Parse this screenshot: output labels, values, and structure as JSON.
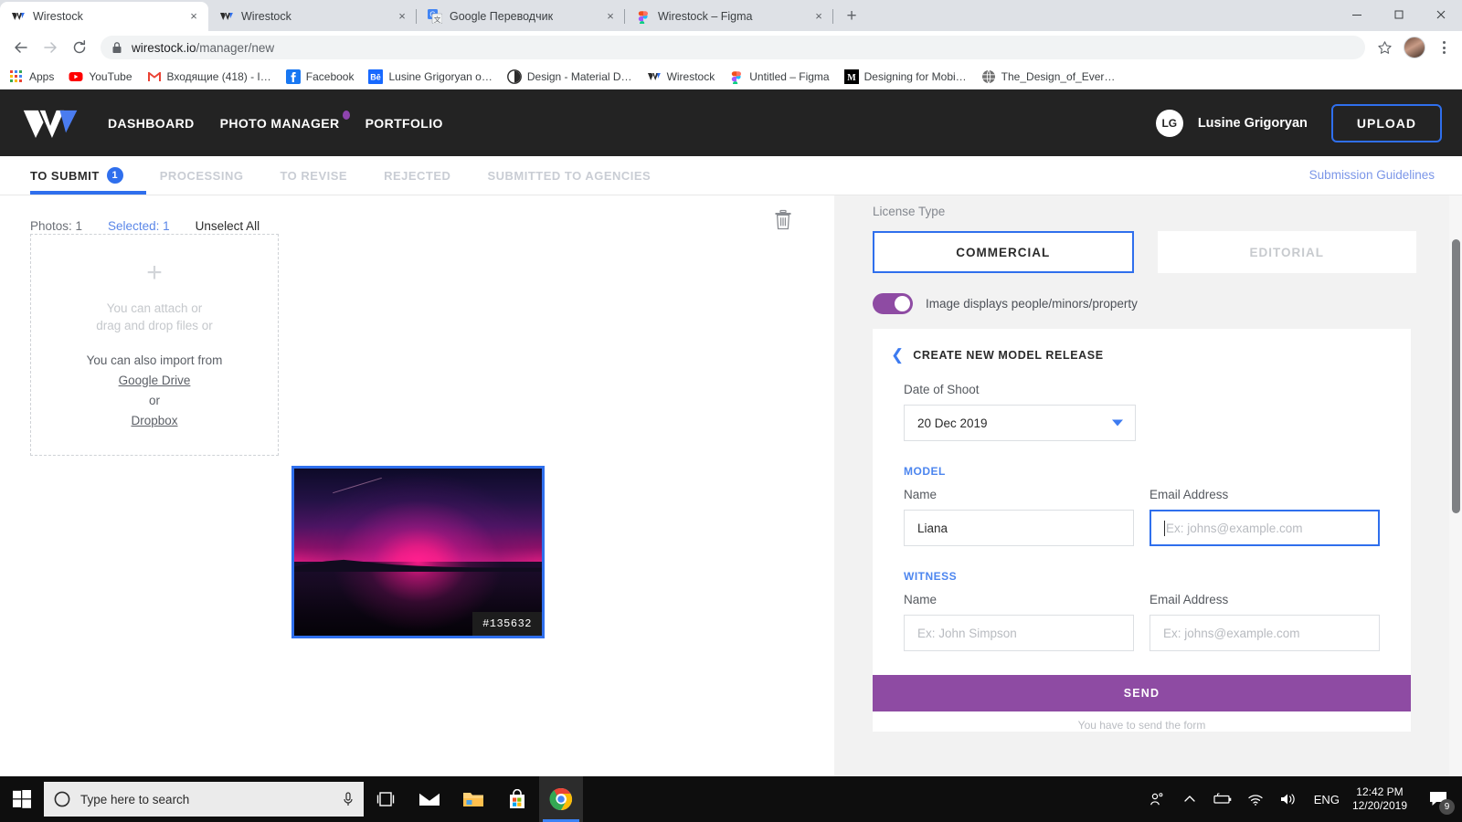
{
  "browser": {
    "tabs": [
      {
        "title": "Wirestock",
        "favicon": "wirestock-icon",
        "active": true,
        "close_label": "×"
      },
      {
        "title": "Wirestock",
        "favicon": "wirestock-icon",
        "active": false,
        "close_label": "×"
      },
      {
        "title": "Google Переводчик",
        "favicon": "google-translate-icon",
        "active": false,
        "close_label": "×"
      },
      {
        "title": "Wirestock – Figma",
        "favicon": "figma-icon",
        "active": false,
        "close_label": "×"
      }
    ],
    "new_tab_label": "+",
    "window_controls": {
      "minimize": "minimize-icon",
      "maximize": "maximize-icon",
      "close": "close-icon"
    },
    "url_host": "wirestock.io",
    "url_path": "/manager/new",
    "bookmarks": [
      {
        "label": "Apps",
        "icon": "apps-grid-icon"
      },
      {
        "label": "YouTube",
        "icon": "youtube-icon"
      },
      {
        "label": "Входящие (418) - I…",
        "icon": "gmail-icon"
      },
      {
        "label": "Facebook",
        "icon": "facebook-icon"
      },
      {
        "label": "Lusine Grigoryan o…",
        "icon": "behance-icon"
      },
      {
        "label": "Design - Material D…",
        "icon": "material-design-icon"
      },
      {
        "label": "Wirestock",
        "icon": "wirestock-icon"
      },
      {
        "label": "Untitled – Figma",
        "icon": "figma-icon"
      },
      {
        "label": "Designing for Mobi…",
        "icon": "medium-icon"
      },
      {
        "label": "The_Design_of_Ever…",
        "icon": "globe-icon"
      }
    ]
  },
  "app": {
    "logo": "wirestock-logo",
    "nav": [
      {
        "label": "DASHBOARD",
        "dot": false
      },
      {
        "label": "PHOTO MANAGER",
        "dot": true
      },
      {
        "label": "PORTFOLIO",
        "dot": false
      }
    ],
    "user": {
      "initials": "LG",
      "name": "Lusine Grigoryan"
    },
    "upload_label": "UPLOAD",
    "tabs": [
      {
        "label": "TO SUBMIT",
        "count": "1",
        "active": true
      },
      {
        "label": "PROCESSING",
        "count": "",
        "active": false
      },
      {
        "label": "TO REVISE",
        "count": "",
        "active": false
      },
      {
        "label": "REJECTED",
        "count": "",
        "active": false
      },
      {
        "label": "SUBMITTED TO AGENCIES",
        "count": "",
        "active": false
      }
    ],
    "guidelines_label": "Submission Guidelines",
    "accent_blue": "#2f6fed",
    "accent_purple": "#8e4ba3"
  },
  "left": {
    "stats": {
      "photos": "Photos: 1",
      "selected": "Selected: 1",
      "unselect_all": "Unselect All"
    },
    "trash_icon": "trash-icon",
    "dropzone": {
      "plus": "+",
      "line1": "You can attach or",
      "line2": "drag and drop files or",
      "line3": "You can also import from",
      "google_drive": "Google Drive",
      "or": "or",
      "dropbox": "Dropbox"
    },
    "photo": {
      "id_badge": "#135632",
      "alt": "pink-sunset-lake-photo"
    }
  },
  "right": {
    "license_type_label": "License Type",
    "license_options": [
      {
        "label": "COMMERCIAL",
        "selected": true
      },
      {
        "label": "EDITORIAL",
        "selected": false
      }
    ],
    "toggle": {
      "label": "Image displays people/minors/property",
      "on": true
    },
    "release_card": {
      "back_icon": "chevron-left-icon",
      "title": "CREATE NEW MODEL RELEASE",
      "date_label": "Date of Shoot",
      "date_value": "20 Dec 2019",
      "model_section": "MODEL",
      "witness_section": "WITNESS",
      "name_label": "Name",
      "email_label": "Email Address",
      "model_name_value": "Liana",
      "model_email_placeholder": "Ex: johns@example.com",
      "witness_name_placeholder": "Ex: John Simpson",
      "witness_email_placeholder": "Ex: johns@example.com",
      "send_label": "SEND",
      "send_note": "You have to send the form"
    }
  },
  "taskbar": {
    "start_icon": "windows-start-icon",
    "search_icon": "cortana-circle-icon",
    "search_placeholder": "Type here to search",
    "mic_icon": "microphone-icon",
    "pinned": [
      {
        "icon": "task-view-icon",
        "name": "task-view",
        "active": false
      },
      {
        "icon": "mail-icon",
        "name": "mail-app",
        "active": false
      },
      {
        "icon": "file-explorer-icon",
        "name": "file-explorer",
        "active": false
      },
      {
        "icon": "microsoft-store-icon",
        "name": "microsoft-store",
        "active": false
      },
      {
        "icon": "chrome-icon",
        "name": "google-chrome",
        "active": true
      }
    ],
    "tray": [
      {
        "icon": "people-icon",
        "name": "people"
      },
      {
        "icon": "chevron-up-icon",
        "name": "show-hidden-icons"
      },
      {
        "icon": "battery-icon",
        "name": "battery"
      },
      {
        "icon": "wifi-icon",
        "name": "network"
      },
      {
        "icon": "volume-icon",
        "name": "volume"
      }
    ],
    "language": "ENG",
    "time": "12:42 PM",
    "date": "12/20/2019",
    "notifications_count": "9"
  }
}
